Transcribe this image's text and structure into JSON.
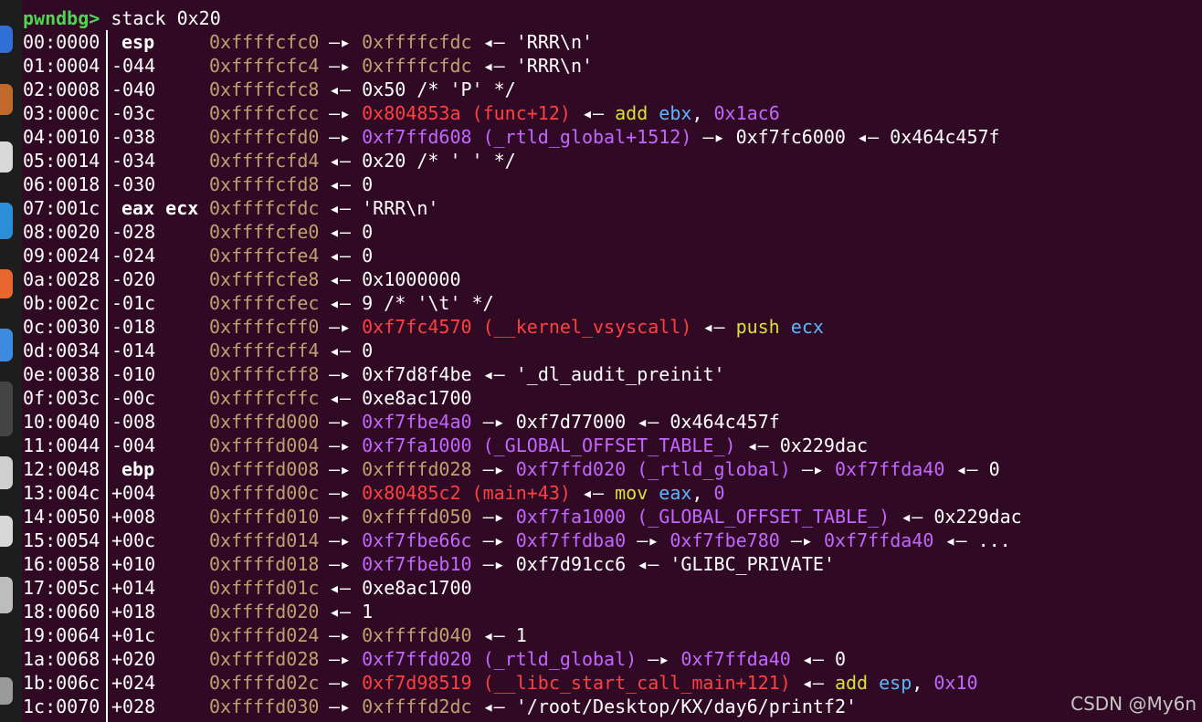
{
  "prompt": {
    "label": "pwndbg>",
    "command": " stack 0x20"
  },
  "watermark": "CSDN @My6n",
  "arrows": {
    "right": "—▸",
    "left": "◂—"
  },
  "colors": {
    "background": "#300a24",
    "prompt": "#4fd64f",
    "stack": "#c0a070",
    "code": "#ff4040",
    "data": "#c266ff",
    "instruction": "#d8e03a",
    "register": "#5ab7ff",
    "text": "#ffffff"
  },
  "rows": [
    {
      "idx": "00:0000",
      "off": "esp",
      "regs": true,
      "addr": "0xffffcfc0",
      "chain": [
        [
          "arrow",
          "right"
        ],
        [
          "stack",
          "0xffffcfdc"
        ],
        [
          "arrow",
          "left"
        ],
        [
          "white",
          "'RRR\\n'"
        ]
      ]
    },
    {
      "idx": "01:0004",
      "off": "-044",
      "addr": "0xffffcfc4",
      "chain": [
        [
          "arrow",
          "right"
        ],
        [
          "stack",
          "0xffffcfdc"
        ],
        [
          "arrow",
          "left"
        ],
        [
          "white",
          "'RRR\\n'"
        ]
      ]
    },
    {
      "idx": "02:0008",
      "off": "-040",
      "addr": "0xffffcfc8",
      "chain": [
        [
          "arrow",
          "left"
        ],
        [
          "white",
          "0x50 /* 'P' */"
        ]
      ]
    },
    {
      "idx": "03:000c",
      "off": "-03c",
      "addr": "0xffffcfcc",
      "chain": [
        [
          "arrow",
          "right"
        ],
        [
          "code",
          "0x804853a (func+12)"
        ],
        [
          "arrow",
          "left"
        ],
        [
          "ins",
          "add"
        ],
        [
          "reg",
          "ebx"
        ],
        [
          "white",
          ","
        ],
        [
          "imm",
          "0x1ac6"
        ]
      ]
    },
    {
      "idx": "04:0010",
      "off": "-038",
      "addr": "0xffffcfd0",
      "chain": [
        [
          "arrow",
          "right"
        ],
        [
          "data",
          "0xf7ffd608 (_rtld_global+1512)"
        ],
        [
          "arrow",
          "right"
        ],
        [
          "white",
          "0xf7fc6000"
        ],
        [
          "arrow",
          "left"
        ],
        [
          "white",
          "0x464c457f"
        ]
      ]
    },
    {
      "idx": "05:0014",
      "off": "-034",
      "addr": "0xffffcfd4",
      "chain": [
        [
          "arrow",
          "left"
        ],
        [
          "white",
          "0x20 /* ' ' */"
        ]
      ]
    },
    {
      "idx": "06:0018",
      "off": "-030",
      "addr": "0xffffcfd8",
      "chain": [
        [
          "arrow",
          "left"
        ],
        [
          "white",
          "0"
        ]
      ]
    },
    {
      "idx": "07:001c",
      "off": "eax ecx",
      "regs": true,
      "addr": "0xffffcfdc",
      "chain": [
        [
          "arrow",
          "left"
        ],
        [
          "white",
          "'RRR\\n'"
        ]
      ]
    },
    {
      "idx": "08:0020",
      "off": "-028",
      "addr": "0xffffcfe0",
      "chain": [
        [
          "arrow",
          "left"
        ],
        [
          "white",
          "0"
        ]
      ]
    },
    {
      "idx": "09:0024",
      "off": "-024",
      "addr": "0xffffcfe4",
      "chain": [
        [
          "arrow",
          "left"
        ],
        [
          "white",
          "0"
        ]
      ]
    },
    {
      "idx": "0a:0028",
      "off": "-020",
      "addr": "0xffffcfe8",
      "chain": [
        [
          "arrow",
          "left"
        ],
        [
          "white",
          "0x1000000"
        ]
      ]
    },
    {
      "idx": "0b:002c",
      "off": "-01c",
      "addr": "0xffffcfec",
      "chain": [
        [
          "arrow",
          "left"
        ],
        [
          "white",
          "9 /* '\\t' */"
        ]
      ]
    },
    {
      "idx": "0c:0030",
      "off": "-018",
      "addr": "0xffffcff0",
      "chain": [
        [
          "arrow",
          "right"
        ],
        [
          "code",
          "0xf7fc4570 (__kernel_vsyscall)"
        ],
        [
          "arrow",
          "left"
        ],
        [
          "ins",
          "push"
        ],
        [
          "reg",
          "ecx"
        ]
      ]
    },
    {
      "idx": "0d:0034",
      "off": "-014",
      "addr": "0xffffcff4",
      "chain": [
        [
          "arrow",
          "left"
        ],
        [
          "white",
          "0"
        ]
      ]
    },
    {
      "idx": "0e:0038",
      "off": "-010",
      "addr": "0xffffcff8",
      "chain": [
        [
          "arrow",
          "right"
        ],
        [
          "white",
          "0xf7d8f4be"
        ],
        [
          "arrow",
          "left"
        ],
        [
          "white",
          "'_dl_audit_preinit'"
        ]
      ]
    },
    {
      "idx": "0f:003c",
      "off": "-00c",
      "addr": "0xffffcffc",
      "chain": [
        [
          "arrow",
          "left"
        ],
        [
          "white",
          "0xe8ac1700"
        ]
      ]
    },
    {
      "idx": "10:0040",
      "off": "-008",
      "addr": "0xffffd000",
      "chain": [
        [
          "arrow",
          "right"
        ],
        [
          "data",
          "0xf7fbe4a0"
        ],
        [
          "arrow",
          "right"
        ],
        [
          "white",
          "0xf7d77000"
        ],
        [
          "arrow",
          "left"
        ],
        [
          "white",
          "0x464c457f"
        ]
      ]
    },
    {
      "idx": "11:0044",
      "off": "-004",
      "addr": "0xffffd004",
      "chain": [
        [
          "arrow",
          "right"
        ],
        [
          "data",
          "0xf7fa1000 (_GLOBAL_OFFSET_TABLE_)"
        ],
        [
          "arrow",
          "left"
        ],
        [
          "white",
          "0x229dac"
        ]
      ]
    },
    {
      "idx": "12:0048",
      "off": "ebp",
      "regs": true,
      "addr": "0xffffd008",
      "chain": [
        [
          "arrow",
          "right"
        ],
        [
          "stack",
          "0xffffd028"
        ],
        [
          "arrow",
          "right"
        ],
        [
          "data",
          "0xf7ffd020 (_rtld_global)"
        ],
        [
          "arrow",
          "right"
        ],
        [
          "data",
          "0xf7ffda40"
        ],
        [
          "arrow",
          "left"
        ],
        [
          "white",
          "0"
        ]
      ]
    },
    {
      "idx": "13:004c",
      "off": "+004",
      "addr": "0xffffd00c",
      "chain": [
        [
          "arrow",
          "right"
        ],
        [
          "code",
          "0x80485c2 (main+43)"
        ],
        [
          "arrow",
          "left"
        ],
        [
          "ins",
          "mov"
        ],
        [
          "reg",
          "eax"
        ],
        [
          "white",
          ","
        ],
        [
          "imm",
          "0"
        ]
      ]
    },
    {
      "idx": "14:0050",
      "off": "+008",
      "addr": "0xffffd010",
      "chain": [
        [
          "arrow",
          "right"
        ],
        [
          "stack",
          "0xffffd050"
        ],
        [
          "arrow",
          "right"
        ],
        [
          "data",
          "0xf7fa1000 (_GLOBAL_OFFSET_TABLE_)"
        ],
        [
          "arrow",
          "left"
        ],
        [
          "white",
          "0x229dac"
        ]
      ]
    },
    {
      "idx": "15:0054",
      "off": "+00c",
      "addr": "0xffffd014",
      "chain": [
        [
          "arrow",
          "right"
        ],
        [
          "data",
          "0xf7fbe66c"
        ],
        [
          "arrow",
          "right"
        ],
        [
          "data",
          "0xf7ffdba0"
        ],
        [
          "arrow",
          "right"
        ],
        [
          "data",
          "0xf7fbe780"
        ],
        [
          "arrow",
          "right"
        ],
        [
          "data",
          "0xf7ffda40"
        ],
        [
          "arrow",
          "left"
        ],
        [
          "white",
          "..."
        ]
      ]
    },
    {
      "idx": "16:0058",
      "off": "+010",
      "addr": "0xffffd018",
      "chain": [
        [
          "arrow",
          "right"
        ],
        [
          "data",
          "0xf7fbeb10"
        ],
        [
          "arrow",
          "right"
        ],
        [
          "white",
          "0xf7d91cc6"
        ],
        [
          "arrow",
          "left"
        ],
        [
          "white",
          "'GLIBC_PRIVATE'"
        ]
      ]
    },
    {
      "idx": "17:005c",
      "off": "+014",
      "addr": "0xffffd01c",
      "chain": [
        [
          "arrow",
          "left"
        ],
        [
          "white",
          "0xe8ac1700"
        ]
      ]
    },
    {
      "idx": "18:0060",
      "off": "+018",
      "addr": "0xffffd020",
      "chain": [
        [
          "arrow",
          "left"
        ],
        [
          "white",
          "1"
        ]
      ]
    },
    {
      "idx": "19:0064",
      "off": "+01c",
      "addr": "0xffffd024",
      "chain": [
        [
          "arrow",
          "right"
        ],
        [
          "stack",
          "0xffffd040"
        ],
        [
          "arrow",
          "left"
        ],
        [
          "white",
          "1"
        ]
      ]
    },
    {
      "idx": "1a:0068",
      "off": "+020",
      "addr": "0xffffd028",
      "chain": [
        [
          "arrow",
          "right"
        ],
        [
          "data",
          "0xf7ffd020 (_rtld_global)"
        ],
        [
          "arrow",
          "right"
        ],
        [
          "data",
          "0xf7ffda40"
        ],
        [
          "arrow",
          "left"
        ],
        [
          "white",
          "0"
        ]
      ]
    },
    {
      "idx": "1b:006c",
      "off": "+024",
      "addr": "0xffffd02c",
      "chain": [
        [
          "arrow",
          "right"
        ],
        [
          "code",
          "0xf7d98519 (__libc_start_call_main+121)"
        ],
        [
          "arrow",
          "left"
        ],
        [
          "ins",
          "add"
        ],
        [
          "reg",
          "esp"
        ],
        [
          "white",
          ","
        ],
        [
          "imm",
          "0x10"
        ]
      ]
    },
    {
      "idx": "1c:0070",
      "off": "+028",
      "addr": "0xffffd030",
      "chain": [
        [
          "arrow",
          "right"
        ],
        [
          "stack",
          "0xffffd2dc"
        ],
        [
          "arrow",
          "left"
        ],
        [
          "white",
          "'/root/Desktop/KX/day6/printf2'"
        ]
      ]
    }
  ]
}
